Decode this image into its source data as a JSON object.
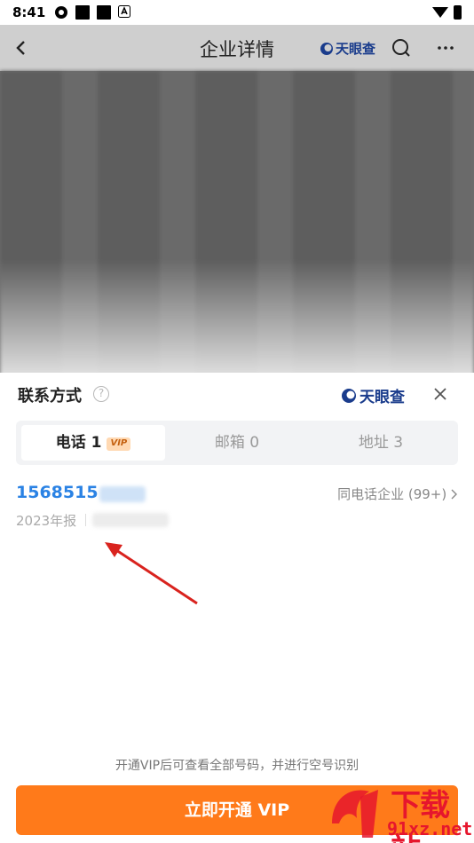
{
  "status_bar": {
    "time": "8:41"
  },
  "nav": {
    "title": "企业详情",
    "logo_text": "天眼查"
  },
  "sheet": {
    "title": "联系方式",
    "help_mark": "?",
    "logo_text": "天眼查",
    "tabs": [
      {
        "label": "电话 1",
        "badge": "VIP",
        "active": true
      },
      {
        "label": "邮箱 0",
        "active": false
      },
      {
        "label": "地址 3",
        "active": false
      }
    ],
    "phone": {
      "number_visible": "1568515",
      "same_phone_label": "同电话企业 (99+)",
      "report_label": "2023年报"
    },
    "hint": "开通VIP后可查看全部号码，并进行空号识别",
    "cta_label": "立即开通 VIP"
  },
  "watermark": {
    "line1": "下载站",
    "line2": "91xz.net"
  },
  "colors": {
    "accent_orange": "#ff7a1a",
    "phone_blue": "#2a82e4",
    "logo_blue": "#1a3c8c",
    "arrow_red": "#d9231e"
  }
}
